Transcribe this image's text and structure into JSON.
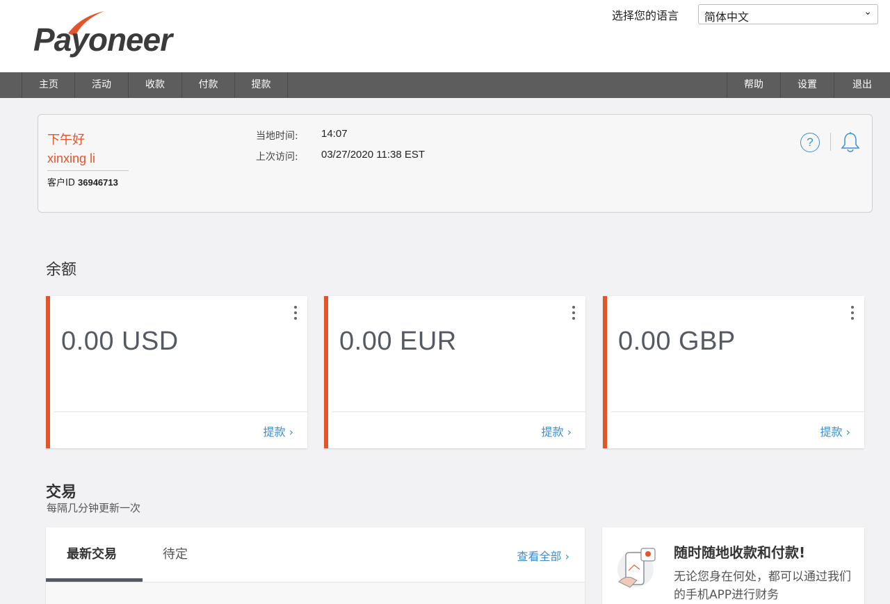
{
  "header": {
    "logo_text": "Payoneer",
    "language_label": "选择您的语言",
    "language_selected": "简体中文"
  },
  "nav": {
    "left": [
      "主页",
      "活动",
      "收款",
      "付款",
      "提款"
    ],
    "right": [
      "帮助",
      "设置",
      "退出"
    ]
  },
  "greeting": {
    "hello": "下午好",
    "name": "xinxing li",
    "customer_id_label": "客户ID",
    "customer_id": "36946713",
    "local_time_label": "当地时间:",
    "local_time": "14:07",
    "last_visit_label": "上次访问:",
    "last_visit": "03/27/2020 11:38 EST"
  },
  "balances": {
    "title": "余额",
    "cards": [
      {
        "amount": "0.00 USD",
        "action": "提款 ›"
      },
      {
        "amount": "0.00 EUR",
        "action": "提款 ›"
      },
      {
        "amount": "0.00 GBP",
        "action": "提款 ›"
      }
    ]
  },
  "transactions": {
    "title": "交易",
    "subtitle": "每隔几分钟更新一次",
    "tabs": [
      "最新交易",
      "待定"
    ],
    "view_all": "查看全部 ›"
  },
  "promo": {
    "title": "随时随地收款和付款!",
    "text": "无论您身在何处，都可以通过我们的手机APP进行财务"
  },
  "colors": {
    "accent": "#e3542a",
    "link": "#3c8fd1",
    "nav_bg": "#5d5d5d"
  }
}
